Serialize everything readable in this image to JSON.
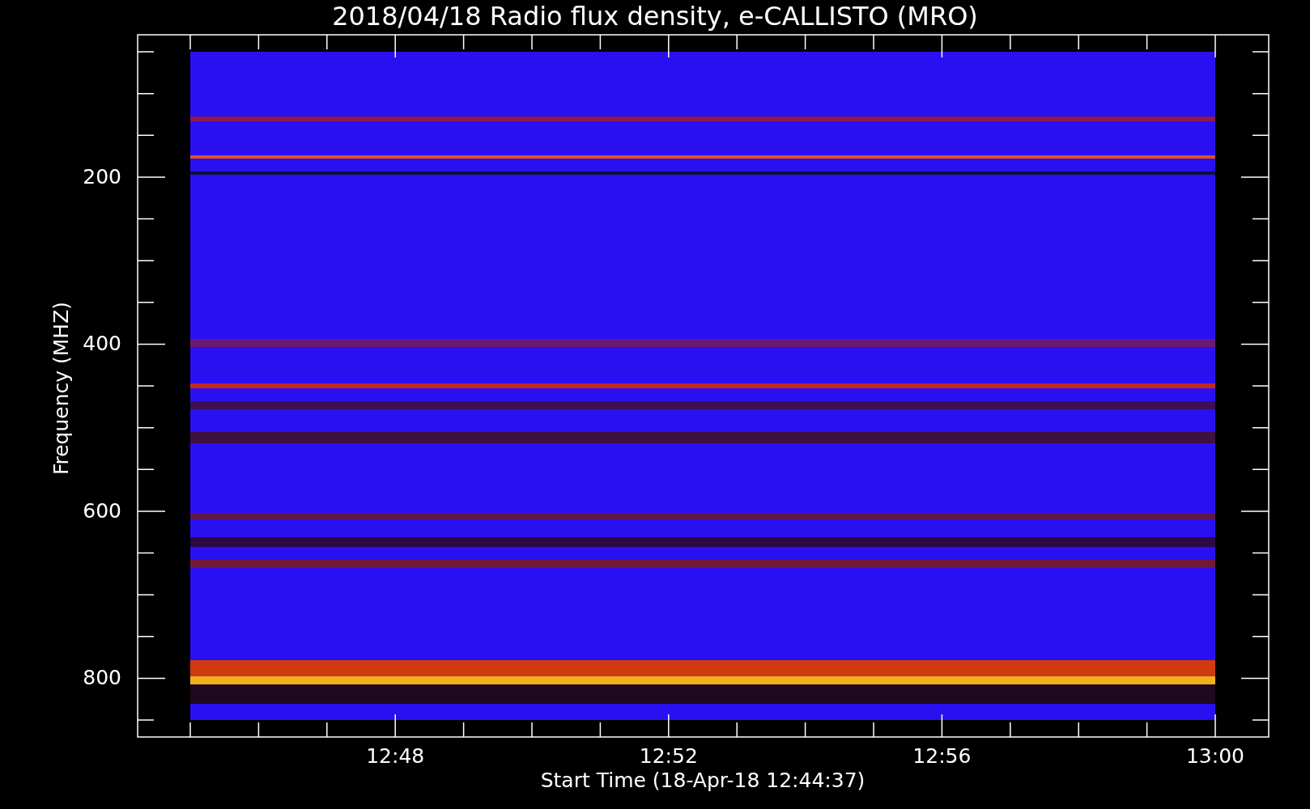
{
  "title": "2018/04/18  Radio flux density, e-CALLISTO (MRO)",
  "y_axis": {
    "label": "Frequency (MHZ)",
    "tick_labels": [
      "200",
      "400",
      "600",
      "800"
    ]
  },
  "x_axis": {
    "label": "Start Time (18-Apr-18 12:44:37)",
    "tick_labels": [
      "12:48",
      "12:52",
      "12:56",
      "13:00"
    ]
  }
}
